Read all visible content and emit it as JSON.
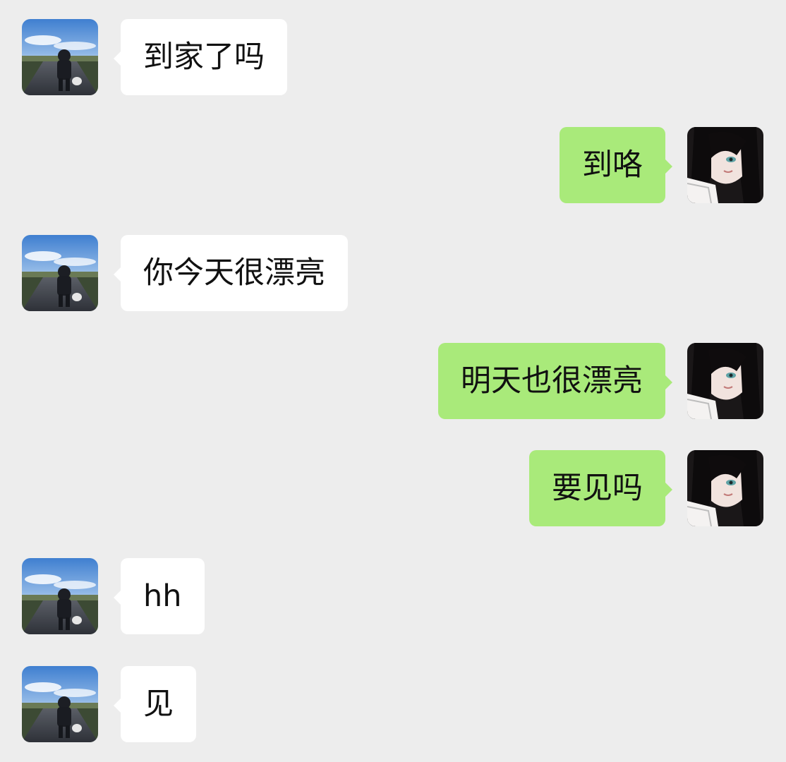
{
  "colors": {
    "background": "#ededed",
    "incoming_bubble": "#ffffff",
    "outgoing_bubble": "#a9ea7a",
    "text": "#111111"
  },
  "messages": [
    {
      "from": "other",
      "text": "到家了吗",
      "avatar": "road-walker-avatar"
    },
    {
      "from": "me",
      "text": "到咯",
      "avatar": "anime-girl-avatar"
    },
    {
      "from": "other",
      "text": "你今天很漂亮",
      "avatar": "road-walker-avatar"
    },
    {
      "from": "me",
      "text": "明天也很漂亮",
      "avatar": "anime-girl-avatar"
    },
    {
      "from": "me",
      "text": "要见吗",
      "avatar": "anime-girl-avatar"
    },
    {
      "from": "other",
      "text": "hh",
      "avatar": "road-walker-avatar"
    },
    {
      "from": "other",
      "text": "见",
      "avatar": "road-walker-avatar"
    }
  ]
}
